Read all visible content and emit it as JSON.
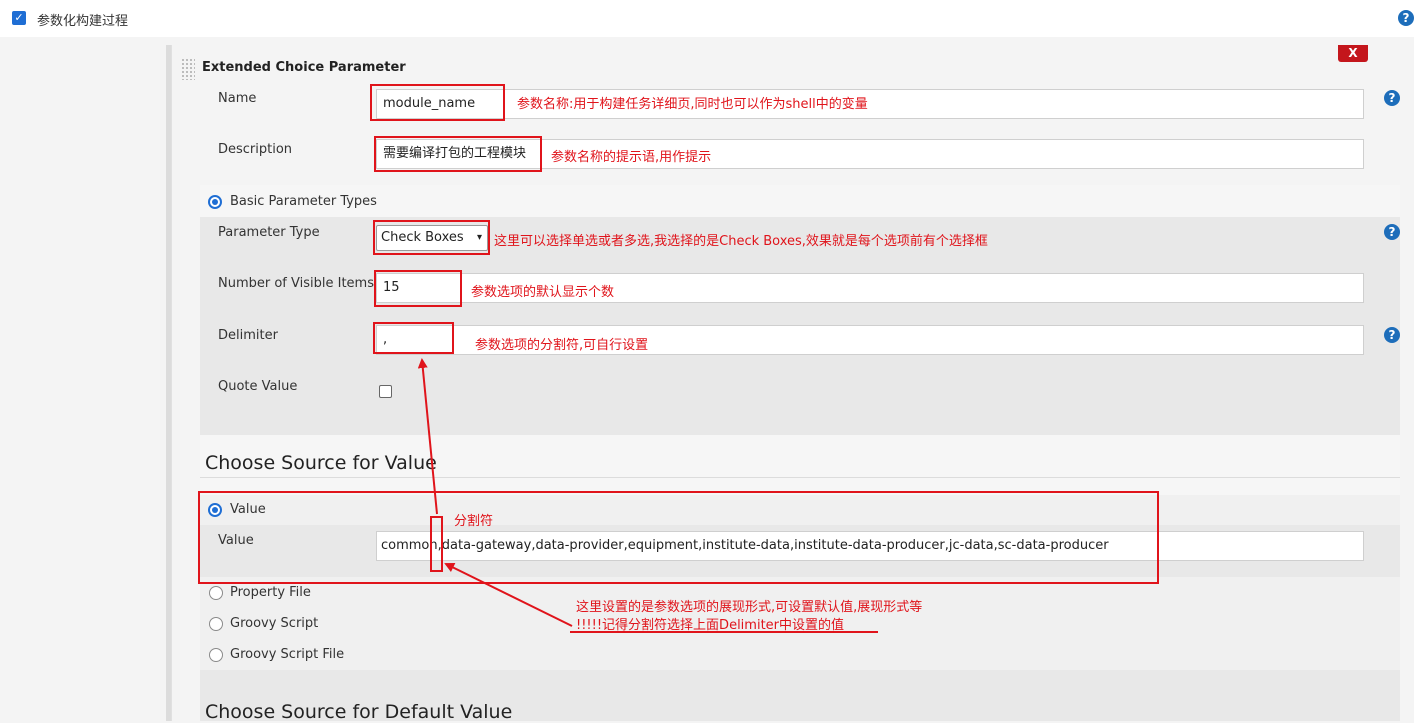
{
  "header": {
    "checkbox_label": "参数化构建过程"
  },
  "param": {
    "title": "Extended Choice Parameter",
    "delete_label": "X",
    "name_label": "Name",
    "name_value": "module_name",
    "description_label": "Description",
    "description_value": "需要编译打包的工程模块",
    "basic_types_label": "Basic Parameter Types",
    "param_type_label": "Parameter Type",
    "param_type_value": "Check Boxes",
    "visible_items_label": "Number of Visible Items",
    "visible_items_value": "15",
    "delimiter_label": "Delimiter",
    "delimiter_value": ",",
    "quote_value_label": "Quote Value",
    "source_heading": "Choose Source for Value",
    "value_radio_label": "Value",
    "value_field_label": "Value",
    "value_field_value": "common,data-gateway,data-provider,equipment,institute-data,institute-data-producer,jc-data,sc-data-producer",
    "property_file_label": "Property File",
    "groovy_script_label": "Groovy Script",
    "groovy_script_file_label": "Groovy Script File",
    "default_heading": "Choose Source for Default Value"
  },
  "annotations": {
    "name_note": "参数名称:用于构建任务详细页,同时也可以作为shell中的变量",
    "desc_note": "参数名称的提示语,用作提示",
    "type_note": "这里可以选择单选或者多选,我选择的是Check Boxes,效果就是每个选项前有个选择框",
    "visible_note": "参数选项的默认显示个数",
    "delim_note": "参数选项的分割符,可自行设置",
    "sep_note": "分割符",
    "source_note1": "这里设置的是参数选项的展现形式,可设置默认值,展现形式等",
    "source_note2": "!!!!!记得分割符选择上面Delimiter中设置的值"
  },
  "colors": {
    "annotation_red": "#e0141b",
    "accent_blue": "#1f6ed4",
    "delete_red": "#c4161c"
  }
}
